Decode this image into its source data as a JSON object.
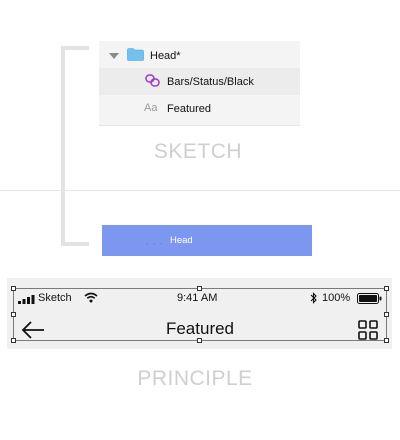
{
  "sketch": {
    "caption": "SKETCH",
    "layers": [
      {
        "label": "Head*",
        "icon": "folder-icon",
        "expanded": true
      },
      {
        "label": "Bars/Status/Black",
        "icon": "symbol-icon"
      },
      {
        "label": "Featured",
        "icon_text": "Aa"
      }
    ]
  },
  "principle": {
    "caption": "PRINCIPLE",
    "selected_layer": "Head",
    "status_bar": {
      "carrier": "Sketch",
      "time": "9:41 AM",
      "battery_pct": "100%"
    },
    "nav_title": "Featured"
  },
  "colors": {
    "folder": "#74c0ee",
    "symbol": "#9b3bc7",
    "selection": "#7c97ef"
  }
}
